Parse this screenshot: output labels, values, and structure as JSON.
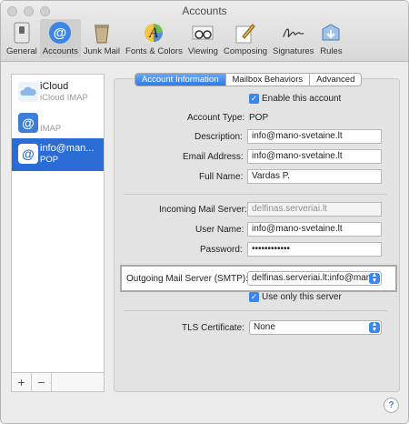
{
  "window": {
    "title": "Accounts"
  },
  "toolbar": {
    "tabs": [
      {
        "label": "General",
        "icon": "switch-icon"
      },
      {
        "label": "Accounts",
        "icon": "at-icon"
      },
      {
        "label": "Junk Mail",
        "icon": "trash-icon"
      },
      {
        "label": "Fonts & Colors",
        "icon": "fonts-icon"
      },
      {
        "label": "Viewing",
        "icon": "glasses-icon"
      },
      {
        "label": "Composing",
        "icon": "pencil-icon"
      },
      {
        "label": "Signatures",
        "icon": "signature-icon"
      },
      {
        "label": "Rules",
        "icon": "rules-icon"
      }
    ],
    "selected_tab": "Accounts"
  },
  "sidebar": {
    "accounts": [
      {
        "name": "iCloud",
        "type": "iCloud IMAP"
      },
      {
        "name": "",
        "type": "IMAP"
      },
      {
        "name": "info@man...",
        "type": "POP"
      }
    ],
    "add_label": "+",
    "remove_label": "−"
  },
  "segments": {
    "items": [
      "Account Information",
      "Mailbox Behaviors",
      "Advanced"
    ],
    "active": "Account Information"
  },
  "form": {
    "enable_label": "Enable this account",
    "enable_checked": true,
    "account_type_label": "Account Type:",
    "account_type_value": "POP",
    "description_label": "Description:",
    "description_value": "info@mano-svetaine.lt",
    "email_label": "Email Address:",
    "email_value": "info@mano-svetaine.lt",
    "fullname_label": "Full Name:",
    "fullname_value": "Vardas P.",
    "incoming_label": "Incoming Mail Server:",
    "incoming_value": "delfinas.serveriai.lt",
    "username_label": "User Name:",
    "username_value": "info@mano-svetaine.lt",
    "password_label": "Password:",
    "password_value": "••••••••••••",
    "outgoing_label": "Outgoing Mail Server (SMTP):",
    "outgoing_value": "delfinas.serveriai.lt:info@mano",
    "use_only_label": "Use only this server",
    "use_only_checked": true,
    "tls_label": "TLS Certificate:",
    "tls_value": "None"
  },
  "help_label": "?",
  "colors": {
    "accent": "#2a6bd6",
    "checkbox": "#3a86f1"
  }
}
